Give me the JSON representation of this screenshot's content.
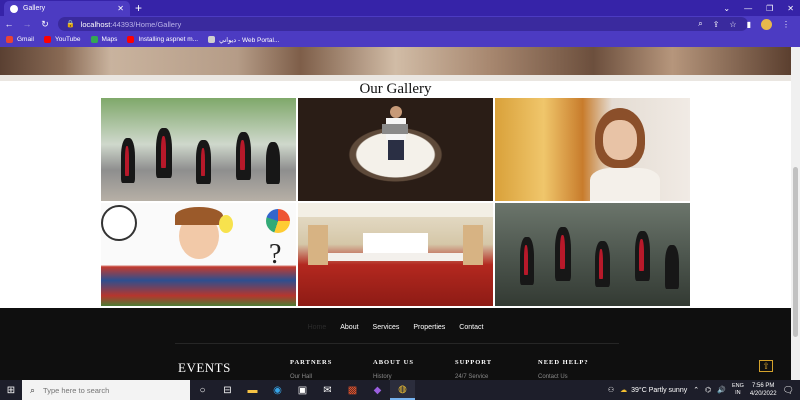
{
  "browser": {
    "tab_title": "Gallery",
    "tab_close": "✕",
    "new_tab": "+",
    "url_host": "localhost",
    "url_path": ":44393/Home/Gallery",
    "window_controls": [
      "⌄",
      "—",
      "❐",
      "✕"
    ],
    "bookmarks": [
      {
        "label": "Gmail",
        "color": "#ea4335"
      },
      {
        "label": "YouTube",
        "color": "#ff0000"
      },
      {
        "label": "Maps",
        "color": "#34a853"
      },
      {
        "label": "Installing aspnet m...",
        "color": "#ff0000"
      },
      {
        "label": "ديواني - Web Portal...",
        "color": "#cfcfcf"
      }
    ]
  },
  "page": {
    "gallery_title": "Our Gallery",
    "photos": [
      {
        "name": "graduates-jumping"
      },
      {
        "name": "coffee-cup-laptop"
      },
      {
        "name": "woman-library"
      },
      {
        "name": "never-stop-learning"
      },
      {
        "name": "conference-hall"
      },
      {
        "name": "graduates-jumping-dark"
      }
    ],
    "footer": {
      "nav": [
        "Home",
        "About",
        "Services",
        "Properties",
        "Contact"
      ],
      "events_title": "EVENTS",
      "columns": [
        {
          "heading": "PARTNERS",
          "link": "Our Hall"
        },
        {
          "heading": "ABOUT US",
          "link": "History"
        },
        {
          "heading": "SUPPORT",
          "link": "24/7 Service"
        },
        {
          "heading": "NEED HELP?",
          "link": "Contact Us"
        }
      ],
      "back_to_top": "⇧"
    }
  },
  "taskbar": {
    "search_placeholder": "Type here to search",
    "weather": "39°C  Partly sunny",
    "lang_line1": "ENG",
    "lang_line2": "IN",
    "time": "7:56 PM",
    "date": "4/20/2022"
  },
  "colors": {
    "browser_frame": "#3623a8",
    "toolbar": "#4c3bc2",
    "footer_bg": "#0f0f0f",
    "accent_gold": "#d4a22c"
  }
}
